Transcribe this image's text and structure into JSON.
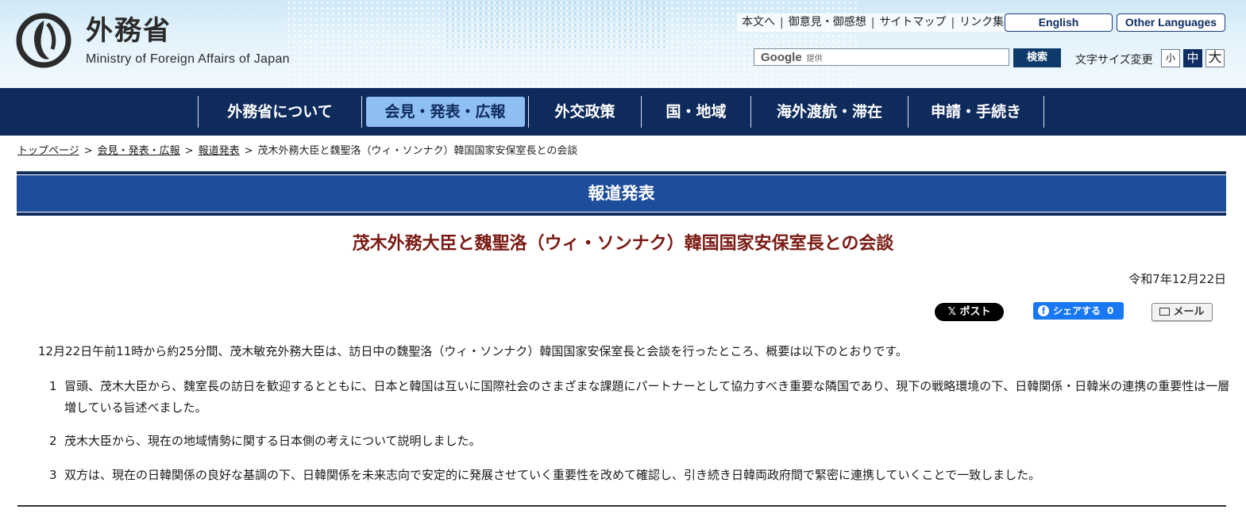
{
  "header": {
    "logo_jp": "外務省",
    "logo_en": "Ministry of Foreign Affairs of Japan",
    "util_links": [
      "本文へ",
      "御意見・御感想",
      "サイトマップ",
      "リンク集"
    ],
    "lang_english": "English",
    "lang_other": "Other Languages",
    "search": {
      "brand": "Google",
      "provided": "提供",
      "value": "",
      "button": "検索"
    },
    "font_size": {
      "label": "文字サイズ変更",
      "small": "小",
      "medium": "中",
      "large": "大",
      "selected": "中"
    }
  },
  "nav": {
    "items": [
      {
        "label": "外務省について"
      },
      {
        "label": "会見・発表・広報",
        "active": true
      },
      {
        "label": "外交政策"
      },
      {
        "label": "国・地域"
      },
      {
        "label": "海外渡航・滞在"
      },
      {
        "label": "申請・手続き"
      }
    ]
  },
  "breadcrumb": {
    "items": [
      "トップページ",
      "会見・発表・広報",
      "報道発表"
    ],
    "current": "茂木外務大臣と魏聖洛（ウィ・ソンナク）韓国国家安保室長との会談",
    "separator": ">"
  },
  "section": {
    "title": "報道発表"
  },
  "article": {
    "title": "茂木外務大臣と魏聖洛（ウィ・ソンナク）韓国国家安保室長との会談",
    "date": "令和7年12月22日",
    "lead": "12月22日午前11時から約25分間、茂木敏充外務大臣は、訪日中の魏聖洛（ウィ・ソンナク）韓国国家安保室長と会談を行ったところ、概要は以下のとおりです。",
    "paragraphs": [
      {
        "num": "1",
        "text": "冒頭、茂木大臣から、魏室長の訪日を歓迎するとともに、日本と韓国は互いに国際社会のさまざまな課題にパートナーとして協力すべき重要な隣国であり、現下の戦略環境の下、日韓関係・日韓米の連携の重要性は一層増している旨述べました。"
      },
      {
        "num": "2",
        "text": "茂木大臣から、現在の地域情勢に関する日本側の考えについて説明しました。"
      },
      {
        "num": "3",
        "text": "双方は、現在の日韓関係の良好な基調の下、日韓関係を未来志向で安定的に発展させていく重要性を改めて確認し、引き続き日韓両政府間で緊密に連携していくことで一致しました。"
      }
    ]
  },
  "share": {
    "x_label": "ポスト",
    "fb_label": "シェアする",
    "fb_count": "0",
    "mail_label": "メール"
  },
  "colors": {
    "nav_bg": "#0e2b5c",
    "section_bg": "#1e4d9b",
    "nav_active": "#8fbef2",
    "title_color": "#7a1a14",
    "fb_blue": "#1877f2"
  }
}
